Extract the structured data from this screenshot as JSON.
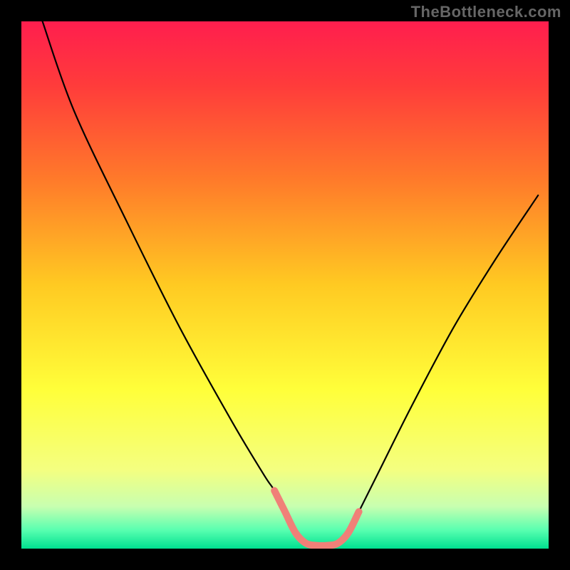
{
  "watermark": "TheBottleneck.com",
  "chart_data": {
    "type": "line",
    "title": "",
    "xlabel": "",
    "ylabel": "",
    "xlim": [
      0,
      100
    ],
    "ylim": [
      0,
      100
    ],
    "grid": false,
    "legend": false,
    "annotations": [],
    "series": [
      {
        "name": "curve",
        "color": "#000000",
        "x": [
          4,
          10,
          20,
          30,
          40,
          46,
          48,
          50,
          52,
          54,
          56,
          58,
          60,
          62,
          64,
          68,
          74,
          82,
          90,
          98
        ],
        "values": [
          100,
          83,
          62,
          42,
          24,
          14,
          11,
          7,
          3,
          1,
          0.6,
          0.6,
          1,
          3,
          7,
          15,
          27,
          42,
          55,
          67
        ]
      },
      {
        "name": "well-bottom-highlight",
        "color": "#f08078",
        "x": [
          48,
          50,
          52,
          54,
          56,
          58,
          60,
          62,
          64
        ],
        "values": [
          11,
          7,
          3,
          1,
          0.6,
          0.6,
          1,
          3,
          7
        ]
      }
    ],
    "background_gradient": {
      "stops": [
        {
          "offset": 0.0,
          "color": "#ff1e4e"
        },
        {
          "offset": 0.12,
          "color": "#ff3b3b"
        },
        {
          "offset": 0.3,
          "color": "#ff7a2a"
        },
        {
          "offset": 0.5,
          "color": "#ffca22"
        },
        {
          "offset": 0.7,
          "color": "#ffff3a"
        },
        {
          "offset": 0.85,
          "color": "#f4ff80"
        },
        {
          "offset": 0.92,
          "color": "#c8ffb0"
        },
        {
          "offset": 0.965,
          "color": "#58ffb0"
        },
        {
          "offset": 1.0,
          "color": "#00e090"
        }
      ]
    }
  }
}
